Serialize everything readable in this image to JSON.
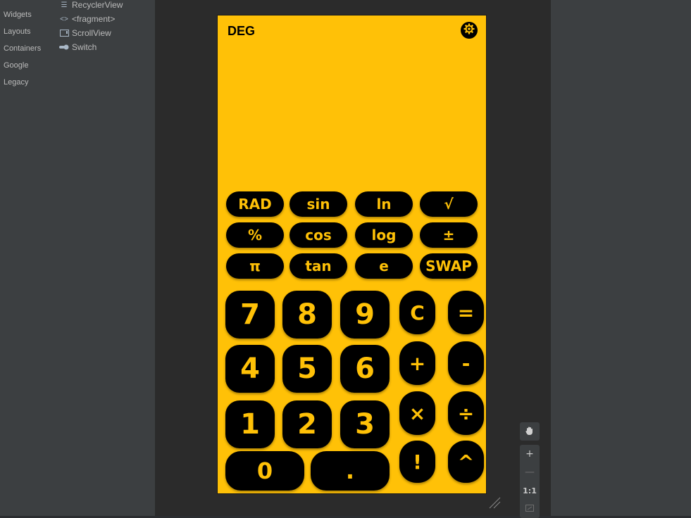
{
  "palette": {
    "categories": [
      "Widgets",
      "Layouts",
      "Containers",
      "Google",
      "Legacy"
    ],
    "items": [
      {
        "label": "RecyclerView",
        "icon": "list-icon"
      },
      {
        "label": "<fragment>",
        "icon": "code-icon"
      },
      {
        "label": "ScrollView",
        "icon": "scrollview-icon"
      },
      {
        "label": "Switch",
        "icon": "switch-icon"
      }
    ]
  },
  "app": {
    "mode_label": "DEG",
    "accent": "#ffc107",
    "scientific_rows": [
      [
        "RAD",
        "sin",
        "ln",
        "√"
      ],
      [
        "%",
        "cos",
        "log",
        "±"
      ],
      [
        "π",
        "tan",
        "e",
        "SWAP"
      ]
    ],
    "digits": {
      "seven": "7",
      "eight": "8",
      "nine": "9",
      "four": "4",
      "five": "5",
      "six": "6",
      "one": "1",
      "two": "2",
      "three": "3",
      "zero": "0",
      "point": "."
    },
    "operators": {
      "clear": "C",
      "equals": "=",
      "plus": "+",
      "minus": "-",
      "multiply": "×",
      "divide": "÷",
      "factorial": "!",
      "power": "^"
    }
  },
  "zoom": {
    "zoom_in": "+",
    "zoom_out": "—",
    "actual_size": "1:1"
  }
}
